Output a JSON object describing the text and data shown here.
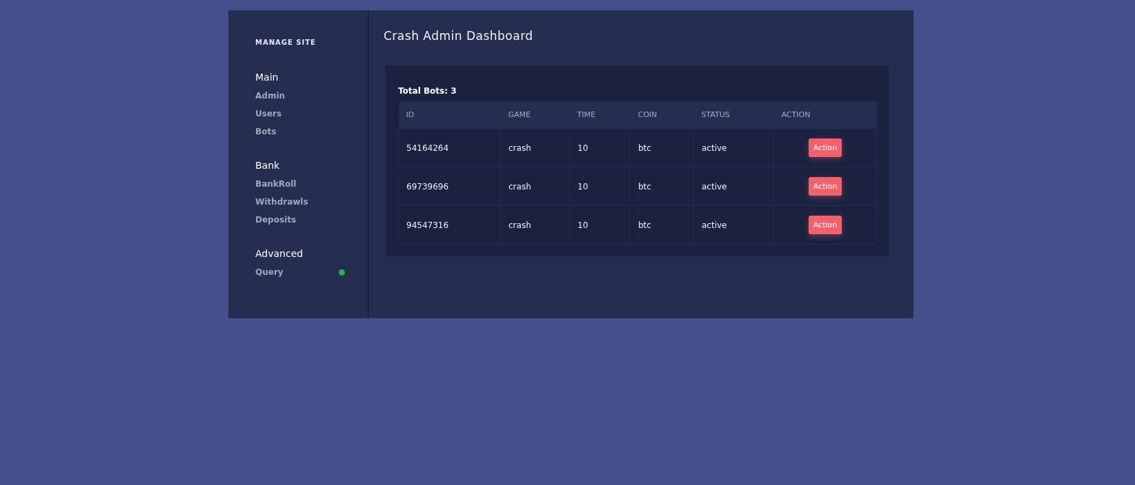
{
  "sidebar": {
    "heading": "MANAGE SITE",
    "sections": [
      {
        "title": "Main",
        "items": [
          {
            "label": "Admin",
            "online": false
          },
          {
            "label": "Users",
            "online": false
          },
          {
            "label": "Bots",
            "online": false
          }
        ]
      },
      {
        "title": "Bank",
        "items": [
          {
            "label": "BankRoll",
            "online": false
          },
          {
            "label": "Withdrawls",
            "online": false
          },
          {
            "label": "Deposits",
            "online": false
          }
        ]
      },
      {
        "title": "Advanced",
        "items": [
          {
            "label": "Query",
            "online": true
          }
        ]
      }
    ]
  },
  "page_title": "Crash Admin Dashboard",
  "table_card": {
    "summary": "Total Bots: 3",
    "columns": [
      "ID",
      "GAME",
      "TIME",
      "COIN",
      "STATUS",
      "ACTION"
    ],
    "rows": [
      {
        "id": "54164264",
        "game": "crash",
        "time": "10",
        "coin": "btc",
        "status": "active",
        "action": "Action"
      },
      {
        "id": "69739696",
        "game": "crash",
        "time": "10",
        "coin": "btc",
        "status": "active",
        "action": "Action"
      },
      {
        "id": "94547316",
        "game": "crash",
        "time": "10",
        "coin": "btc",
        "status": "active",
        "action": "Action"
      }
    ]
  }
}
